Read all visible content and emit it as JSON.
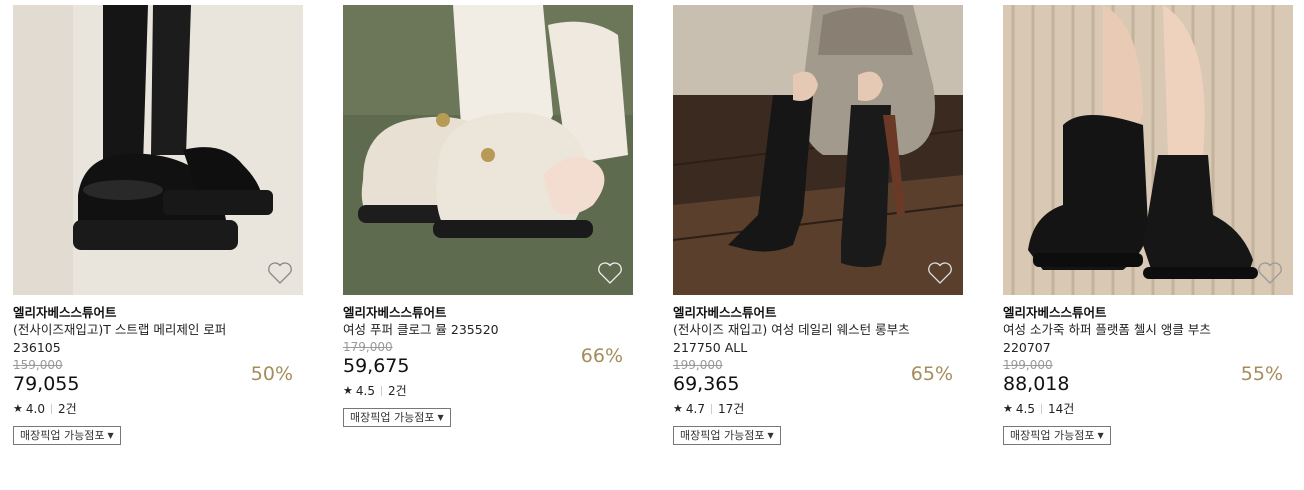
{
  "products": [
    {
      "brand": "엘리자베스스튜어트",
      "name": "(전사이즈재입고)T 스트랩 메리제인 로퍼 236105",
      "original_price": "159,000",
      "price": "79,055",
      "discount": "50%",
      "rating": "4.0",
      "reviews": "2건",
      "pickup_label": "매장픽업 가능점포",
      "image_icon": "mary-jane-loafer-photo"
    },
    {
      "brand": "엘리자베스스튜어트",
      "name": "여성 푸퍼 클로그 뮬 235520",
      "original_price": "179,000",
      "price": "59,675",
      "discount": "66%",
      "rating": "4.5",
      "reviews": "2건",
      "pickup_label": "매장픽업 가능점포",
      "image_icon": "puffer-clog-photo"
    },
    {
      "brand": "엘리자베스스튜어트",
      "name": "(전사이즈 재입고) 여성 데일리 웨스턴 롱부츠 217750 ALL",
      "original_price": "199,000",
      "price": "69,365",
      "discount": "65%",
      "rating": "4.7",
      "reviews": "17건",
      "pickup_label": "매장픽업 가능점포",
      "image_icon": "western-long-boots-photo"
    },
    {
      "brand": "엘리자베스스튜어트",
      "name": "여성 소가죽 하퍼 플랫폼 첼시 앵클 부츠 220707",
      "original_price": "199,000",
      "price": "88,018",
      "discount": "55%",
      "rating": "4.5",
      "reviews": "14건",
      "pickup_label": "매장픽업 가능점포",
      "image_icon": "chelsea-ankle-boots-photo"
    }
  ],
  "colors": {
    "discount": "#a58d5b",
    "strike": "#999999",
    "border": "#777777"
  }
}
